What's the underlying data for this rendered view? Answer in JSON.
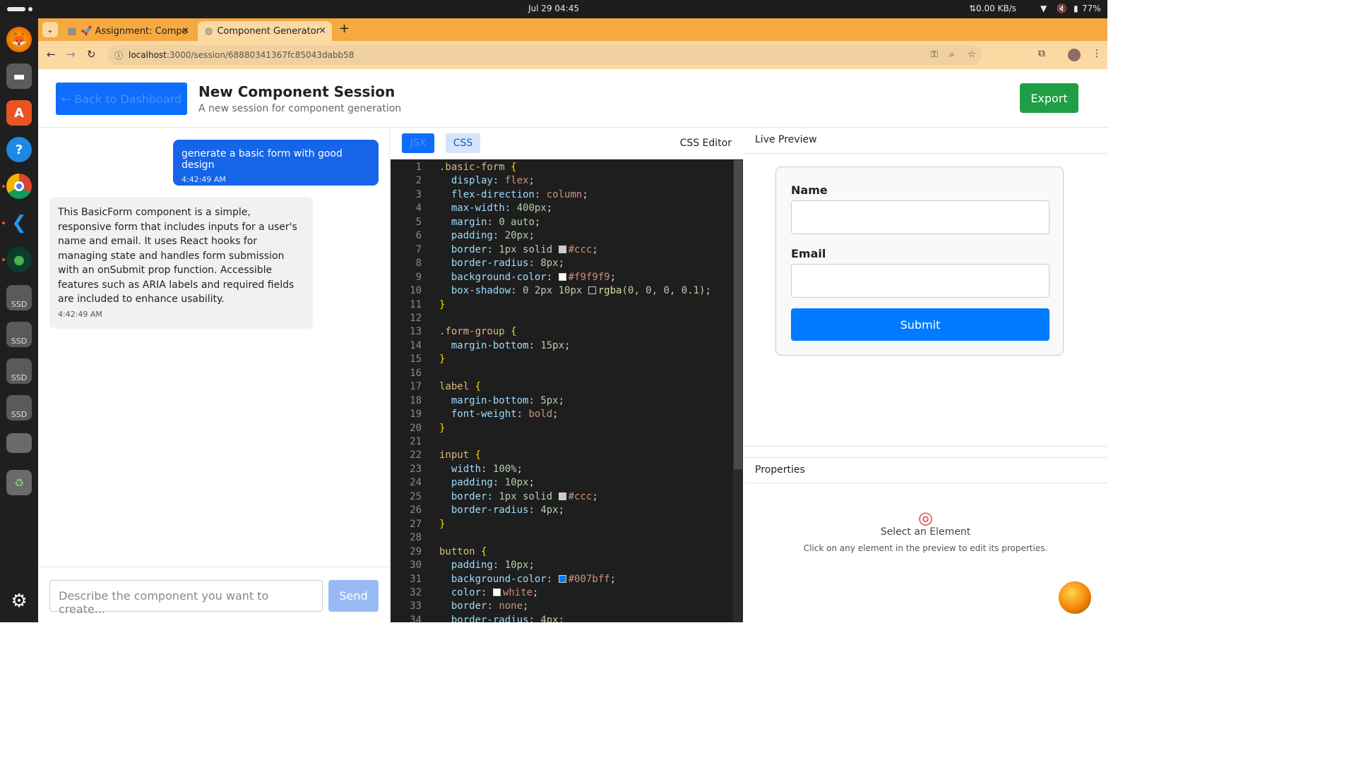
{
  "system": {
    "clock": "Jul 29  04:45",
    "network": "⇅0.00 KB/s",
    "battery": "77%"
  },
  "dock": {
    "ssd_label": "SSD"
  },
  "browser": {
    "tabs": [
      {
        "label": "🚀 Assignment: Compo",
        "close": "×"
      },
      {
        "label": "Component Generator",
        "close": "×"
      }
    ],
    "new_tab": "+",
    "url_host": "localhost",
    "url_rest": ":3000/session/68880341367fc85043dabb58"
  },
  "header": {
    "back_label": "← Back to Dashboard",
    "title": "New Component Session",
    "subtitle": "A new session for component generation",
    "export_label": "Export"
  },
  "chat": {
    "user_message": {
      "text": "generate a basic form with good design",
      "time": "4:42:49 AM"
    },
    "assistant_message": {
      "text": "This BasicForm component is a simple, responsive form that includes inputs for a user's name and email. It uses React hooks for managing state and handles form submission with an onSubmit prop function. Accessible features such as ARIA labels and required fields are included to enhance usability.",
      "time": "4:42:49 AM"
    },
    "input_placeholder": "Describe the component you want to create...",
    "send_label": "Send"
  },
  "editor": {
    "tabs": [
      "JSX",
      "CSS"
    ],
    "title": "CSS Editor",
    "line_numbers": [
      "1",
      "2",
      "3",
      "4",
      "5",
      "6",
      "7",
      "8",
      "9",
      "10",
      "11",
      "12",
      "13",
      "14",
      "15",
      "16",
      "17",
      "18",
      "19",
      "20",
      "21",
      "22",
      "23",
      "24",
      "25",
      "26",
      "27",
      "28",
      "29",
      "30",
      "31",
      "32",
      "33",
      "34"
    ],
    "swatch_colors": {
      "ccc": "#cccccc",
      "f9f9f9": "#f9f9f9",
      "shadow": "#1e1e1e",
      "blue": "#007bff",
      "white": "#ffffff"
    },
    "code": {
      "l1_sel": ".basic-form",
      "l1_br": " {",
      "l2_p": "display",
      "l2_v": "flex",
      "l3_p": "flex-direction",
      "l3_v": "column",
      "l4_p": "max-width",
      "l4_v": "400px",
      "l5_p": "margin",
      "l5_v": "0 auto",
      "l6_p": "padding",
      "l6_v": "20px",
      "l7_p": "border",
      "l7_v1": "1px solid ",
      "l7_v2": "#ccc",
      "l8_p": "border-radius",
      "l8_v": "8px",
      "l9_p": "background-color",
      "l9_v": "#f9f9f9",
      "l10_p": "box-shadow",
      "l10_v1": "0 2px 10px ",
      "l10_fn": "rgba",
      "l10_v2": "(0, 0, 0, 0.1)",
      "close": "}",
      "l13_sel": ".form-group",
      "l14_p": "margin-bottom",
      "l14_v": "15px",
      "l17_sel": "label",
      "l18_p": "margin-bottom",
      "l18_v": "5px",
      "l19_p": "font-weight",
      "l19_v": "bold",
      "l22_sel": "input",
      "l23_p": "width",
      "l23_v": "100%",
      "l24_p": "padding",
      "l24_v": "10px",
      "l25_p": "border",
      "l25_v1": "1px solid ",
      "l25_v2": "#ccc",
      "l26_p": "border-radius",
      "l26_v": "4px",
      "l29_sel": "button",
      "l30_p": "padding",
      "l30_v": "10px",
      "l31_p": "background-color",
      "l31_v": "#007bff",
      "l32_p": "color",
      "l32_v": "white",
      "l33_p": "border",
      "l33_v": "none",
      "l34_p": "border-radius",
      "l34_v": "4px"
    }
  },
  "preview": {
    "title": "Live Preview",
    "name_label": "Name",
    "email_label": "Email",
    "submit_label": "Submit"
  },
  "properties": {
    "title": "Properties",
    "select_title": "Select an Element",
    "select_desc": "Click on any element in the preview to edit its properties."
  }
}
